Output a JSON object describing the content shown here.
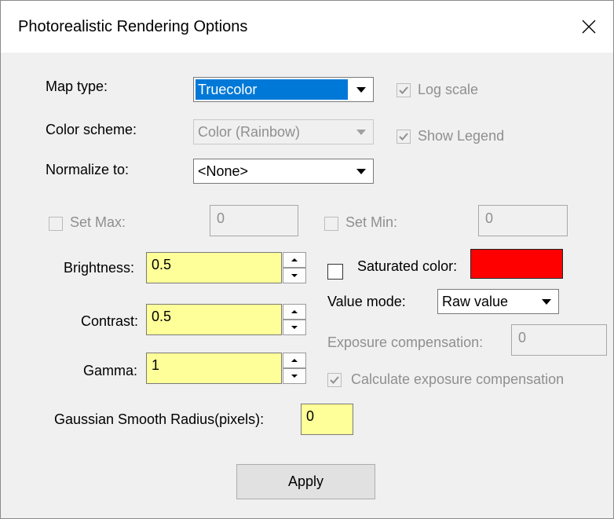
{
  "window": {
    "title": "Photorealistic Rendering Options"
  },
  "map_type": {
    "label": "Map type:",
    "value": "Truecolor"
  },
  "color_scheme": {
    "label": "Color scheme:",
    "value": "Color (Rainbow)"
  },
  "normalize": {
    "label": "Normalize to:",
    "value": "<None>"
  },
  "log_scale": {
    "label": "Log scale",
    "checked": true,
    "enabled": false
  },
  "show_legend": {
    "label": "Show Legend",
    "checked": true,
    "enabled": false
  },
  "set_max": {
    "label": "Set Max:",
    "value": "0",
    "checked": false,
    "enabled": false
  },
  "set_min": {
    "label": "Set Min:",
    "value": "0",
    "checked": false,
    "enabled": false
  },
  "brightness": {
    "label": "Brightness:",
    "value": "0.5"
  },
  "contrast": {
    "label": "Contrast:",
    "value": "0.5"
  },
  "gamma": {
    "label": "Gamma:",
    "value": "1"
  },
  "saturated_color": {
    "label": "Saturated color:",
    "checked": false,
    "color": "#ff0000"
  },
  "value_mode": {
    "label": "Value mode:",
    "value": "Raw value"
  },
  "exposure_compensation": {
    "label": "Exposure compensation:",
    "value": "0",
    "enabled": false
  },
  "calc_exposure": {
    "label": "Calculate exposure compensation",
    "checked": true,
    "enabled": false
  },
  "gaussian": {
    "label": "Gaussian Smooth Radius(pixels):",
    "value": "0"
  },
  "apply_button": {
    "label": "Apply"
  },
  "colors": {
    "selection": "#0078d7",
    "input_highlight": "#ffff99",
    "disabled_text": "#8f8f8f"
  },
  "icons": {
    "close": "close-icon",
    "dropdown": "chevron-down-icon",
    "spin_up": "arrow-up-icon",
    "spin_down": "arrow-down-icon",
    "check": "checkmark-icon"
  }
}
